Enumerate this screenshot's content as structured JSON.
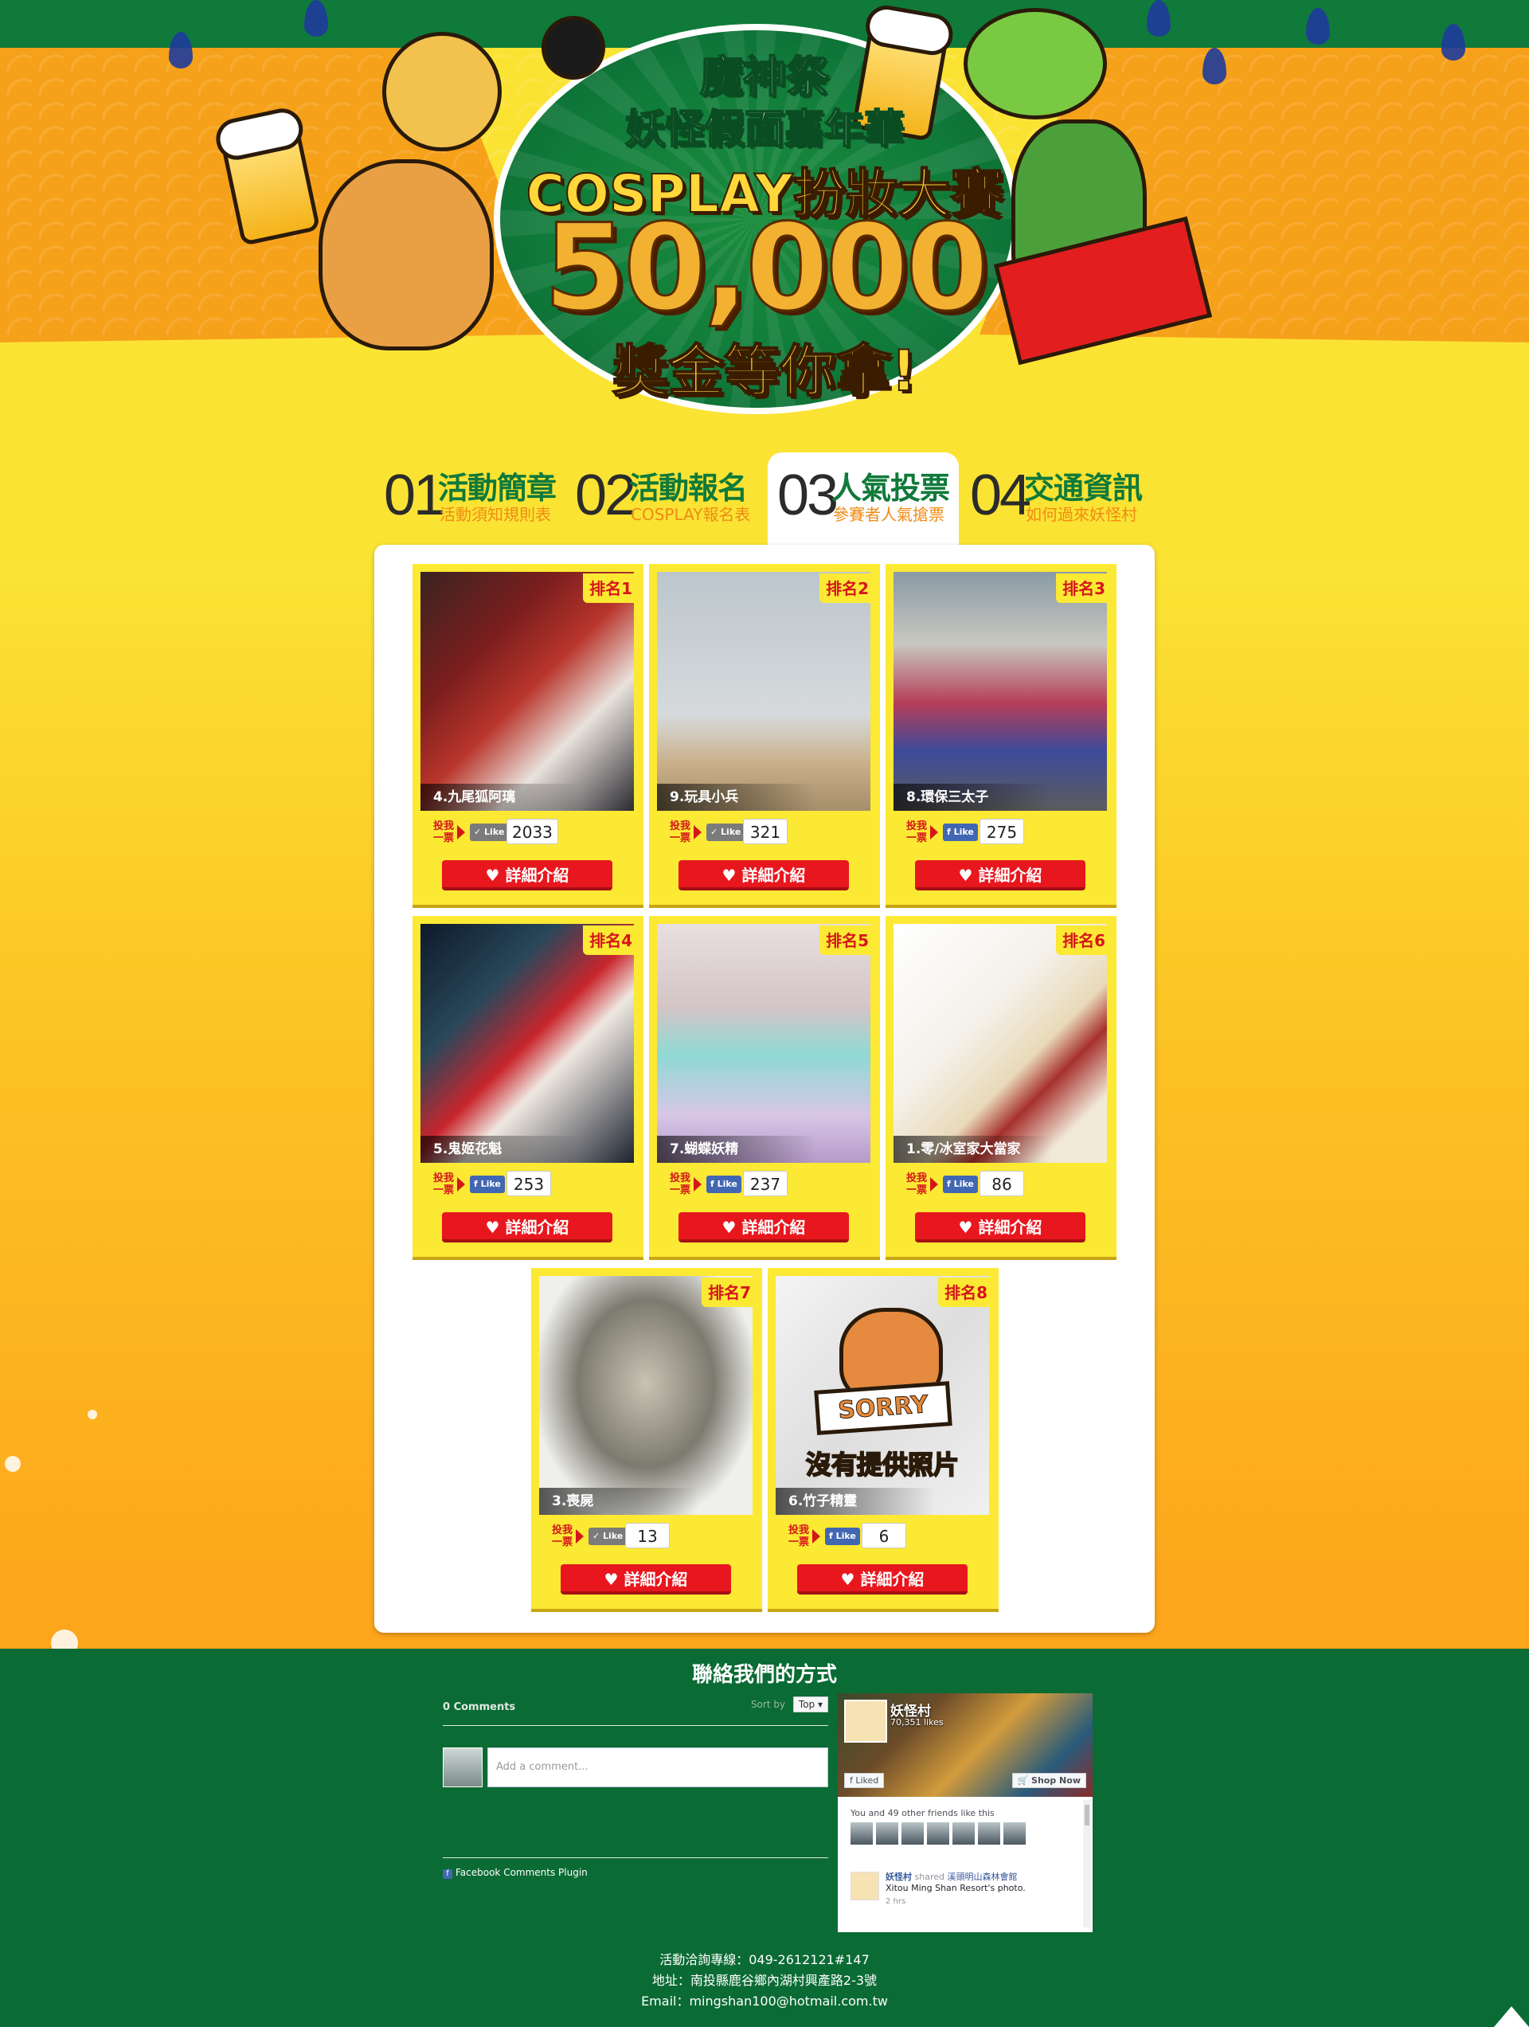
{
  "banner": {
    "line1": "魔神祭",
    "line2": "妖怪假面嘉年華",
    "line3": "COSPLAY扮妝大賽",
    "prize": "50,000",
    "line5": "獎金等你拿!"
  },
  "nav": {
    "tabs": [
      {
        "num": "01",
        "title": "活動簡章",
        "sub": "活動須知規則表"
      },
      {
        "num": "02",
        "title": "活動報名",
        "sub": "COSPLAY報名表"
      },
      {
        "num": "03",
        "title": "人氣投票",
        "sub": "參賽者人氣搶票"
      },
      {
        "num": "04",
        "title": "交通資訊",
        "sub": "如何過來妖怪村"
      }
    ]
  },
  "vote_label": "投我一票",
  "detail_label": "詳細介紹",
  "like_label": "Like",
  "entries": [
    {
      "rank": "排名1",
      "name": "4.九尾狐阿璃",
      "count": "2033",
      "liked": true
    },
    {
      "rank": "排名2",
      "name": "9.玩具小兵",
      "count": "321",
      "liked": true
    },
    {
      "rank": "排名3",
      "name": "8.環保三太子",
      "count": "275",
      "liked": false
    },
    {
      "rank": "排名4",
      "name": "5.鬼姬花魁",
      "count": "253",
      "liked": false
    },
    {
      "rank": "排名5",
      "name": "7.蝴蝶妖精",
      "count": "237",
      "liked": false
    },
    {
      "rank": "排名6",
      "name": "1.零/冰室家大當家",
      "count": "86",
      "liked": false
    },
    {
      "rank": "排名7",
      "name": "3.喪屍",
      "count": "13",
      "liked": true
    },
    {
      "rank": "排名8",
      "name": "6.竹子精靈",
      "count": "6",
      "liked": false
    }
  ],
  "sorry": {
    "board": "SORRY",
    "text": "沒有提供照片"
  },
  "footer": {
    "title": "聯絡我們的方式",
    "comments": {
      "count": "0 Comments",
      "sort_label": "Sort by",
      "sort_value": "Top",
      "placeholder": "Add a comment...",
      "plugin": "Facebook Comments Plugin"
    },
    "fbpage": {
      "name": "妖怪村",
      "likes": "70,351 likes",
      "liked": "Liked",
      "shop": "Shop Now",
      "friends": "You and 49 other friends like this",
      "post_author": "妖怪村",
      "post_shared": "shared",
      "post_target": "溪頭明山森林會館",
      "post_line2": "Xitou Ming Shan Resort's photo.",
      "post_time": "2 hrs"
    },
    "info": [
      "活動洽詢專線：049-2612121#147",
      "地址：南投縣鹿谷鄉內湖村興產路2-3號",
      "Email：mingshan100@hotmail.com.tw"
    ]
  },
  "colors": {
    "green": "#0f7a3a",
    "yellow": "#fce934",
    "red": "#e8171e",
    "orange": "#f6a11a"
  }
}
